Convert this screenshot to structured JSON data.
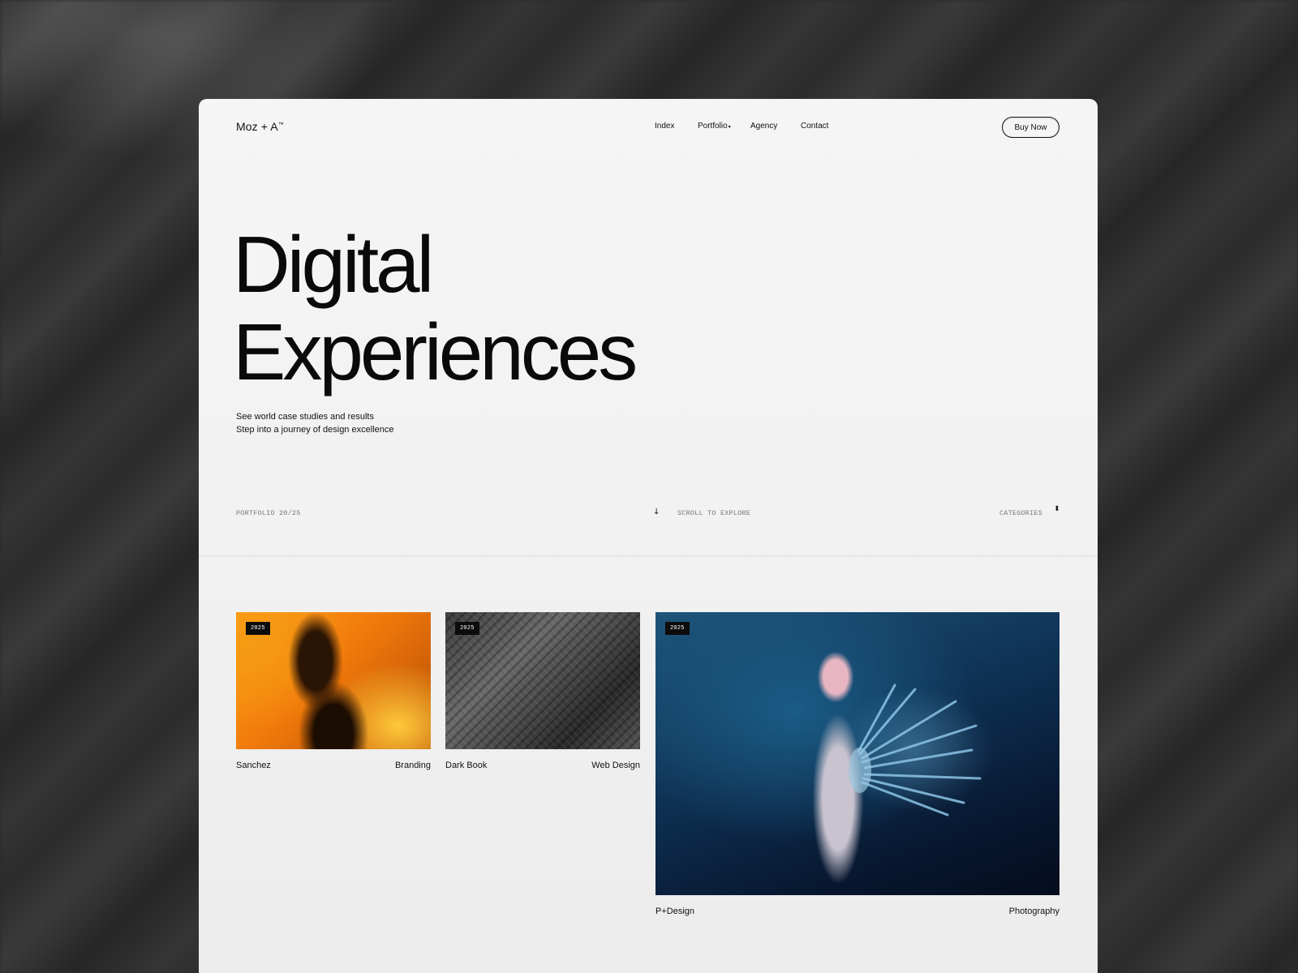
{
  "brand": {
    "name": "Moz + A",
    "mark": "™"
  },
  "nav": {
    "items": [
      "Index",
      "Portfolio",
      "Agency",
      "Contact"
    ],
    "portfolio_caret": "▾"
  },
  "header": {
    "cta_label": "Buy Now"
  },
  "hero": {
    "title_line1": "Digital",
    "title_line2": "Experiences",
    "sub_line1": "See world case studies and results",
    "sub_line2": "Step into a journey of design excellence"
  },
  "info_bar": {
    "portfolio_count": "PORTFOLIO 20/25",
    "scroll_arrow": "↓",
    "scroll_label": "SCROLL TO EXPLORE",
    "categories_label": "CATEGORIES",
    "categories_icon": "⬍"
  },
  "projects": [
    {
      "year": "2025",
      "name": "Sanchez",
      "category": "Branding"
    },
    {
      "year": "2025",
      "name": "Dark Book",
      "category": "Web Design"
    },
    {
      "year": "2025",
      "name": "P+Design",
      "category": "Photography"
    }
  ],
  "colors": {
    "ink": "#111111",
    "panel": "#f4f4f4",
    "badge": "#0c0c0c"
  }
}
